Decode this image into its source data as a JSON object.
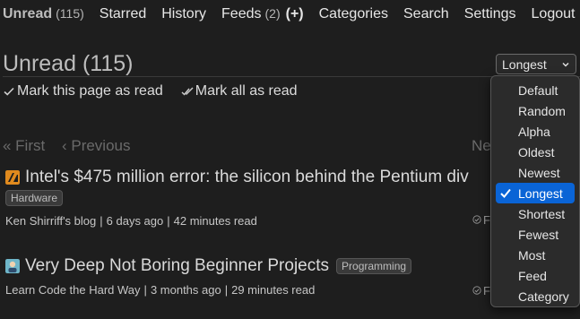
{
  "nav": {
    "unread_label": "Unread",
    "unread_count": "(115)",
    "starred": "Starred",
    "history": "History",
    "feeds_label": "Feeds",
    "feeds_count": "(2)",
    "feeds_add": "(+)",
    "categories": "Categories",
    "search": "Search",
    "settings": "Settings",
    "logout": "Logout"
  },
  "page": {
    "title": "Unread (115)",
    "mark_page_read": "Mark this page as read",
    "mark_all_read": "Mark all as read"
  },
  "pager": {
    "first": "« First",
    "previous": "‹ Previous",
    "next": "Ne"
  },
  "sort": {
    "selected": "Longest",
    "options": [
      "Default",
      "Random",
      "Alpha",
      "Oldest",
      "Newest",
      "Longest",
      "Shortest",
      "Fewest",
      "Most",
      "Feed",
      "Category"
    ]
  },
  "entries": [
    {
      "title": "Intel's $475 million error: the silicon behind the Pentium div",
      "tag": "Hardware",
      "feed": "Ken Shirriff's blog",
      "age": "6 days ago",
      "read_time": "42 minutes read",
      "mark_read_partial": "F",
      "favicon": "blog-favicon"
    },
    {
      "title": "Very Deep Not Boring Beginner Projects",
      "tag": "Programming",
      "feed": "Learn Code the Hard Way",
      "age": "3 months ago",
      "read_time": "29 minutes read",
      "mark_read_partial": "F",
      "favicon": "learncode-favicon"
    }
  ],
  "separator": "|",
  "colors": {
    "background": "#1e1e1e",
    "selection": "#0a64d6",
    "text": "#dcdcdc"
  }
}
